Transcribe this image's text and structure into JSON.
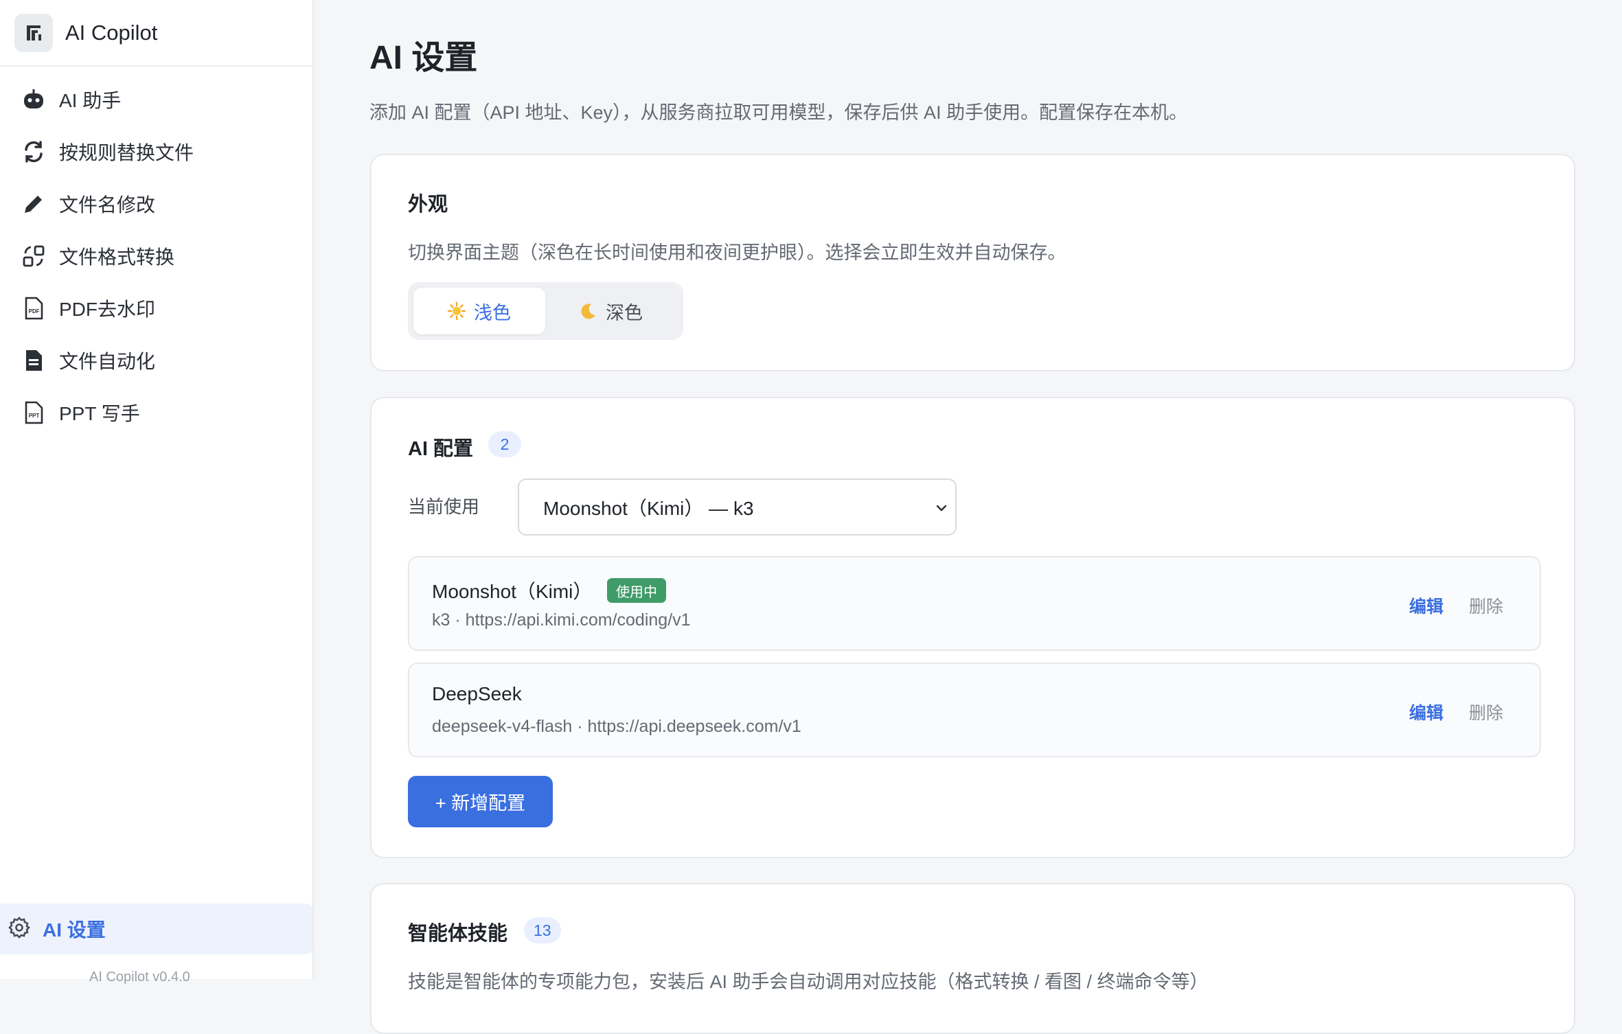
{
  "app": {
    "title": "AI Copilot",
    "version": "AI Copilot v0.4.0"
  },
  "sidebar": {
    "items": [
      {
        "label": "AI 助手",
        "icon": "robot-icon"
      },
      {
        "label": "按规则替换文件",
        "icon": "refresh-icon"
      },
      {
        "label": "文件名修改",
        "icon": "pencil-icon"
      },
      {
        "label": "文件格式转换",
        "icon": "convert-icon"
      },
      {
        "label": "PDF去水印",
        "icon": "pdf-file-icon"
      },
      {
        "label": "文件自动化",
        "icon": "document-icon"
      },
      {
        "label": "PPT 写手",
        "icon": "ppt-file-icon"
      }
    ],
    "settings": {
      "label": "AI 设置",
      "icon": "gear-icon"
    }
  },
  "page": {
    "title": "AI 设置",
    "description": "添加 AI 配置（API 地址、Key），从服务商拉取可用模型，保存后供 AI 助手使用。配置保存在本机。"
  },
  "appearance": {
    "title": "外观",
    "description": "切换界面主题（深色在长时间使用和夜间更护眼）。选择会立即生效并自动保存。",
    "options": [
      {
        "label": "浅色",
        "icon": "sun-icon",
        "active": true
      },
      {
        "label": "深色",
        "icon": "moon-icon",
        "active": false
      }
    ]
  },
  "ai_config": {
    "title": "AI 配置",
    "count": "2",
    "current_label": "当前使用",
    "current_value": "Moonshot（Kimi） — k3",
    "configs": [
      {
        "name": "Moonshot（Kimi）",
        "tag": "使用中",
        "detail": "k3 · https://api.kimi.com/coding/v1",
        "edit": "编辑",
        "delete": "删除"
      },
      {
        "name": "DeepSeek",
        "tag": "",
        "detail": "deepseek-v4-flash · https://api.deepseek.com/v1",
        "edit": "编辑",
        "delete": "删除"
      }
    ],
    "add_label": "+ 新增配置"
  },
  "skills": {
    "title": "智能体技能",
    "count": "13",
    "description": "技能是智能体的专项能力包，安装后 AI 助手会自动调用对应技能（格式转换 / 看图 / 终端命令等）"
  },
  "colors": {
    "accent": "#3a6fe0",
    "active_tag": "#3f9b68"
  }
}
